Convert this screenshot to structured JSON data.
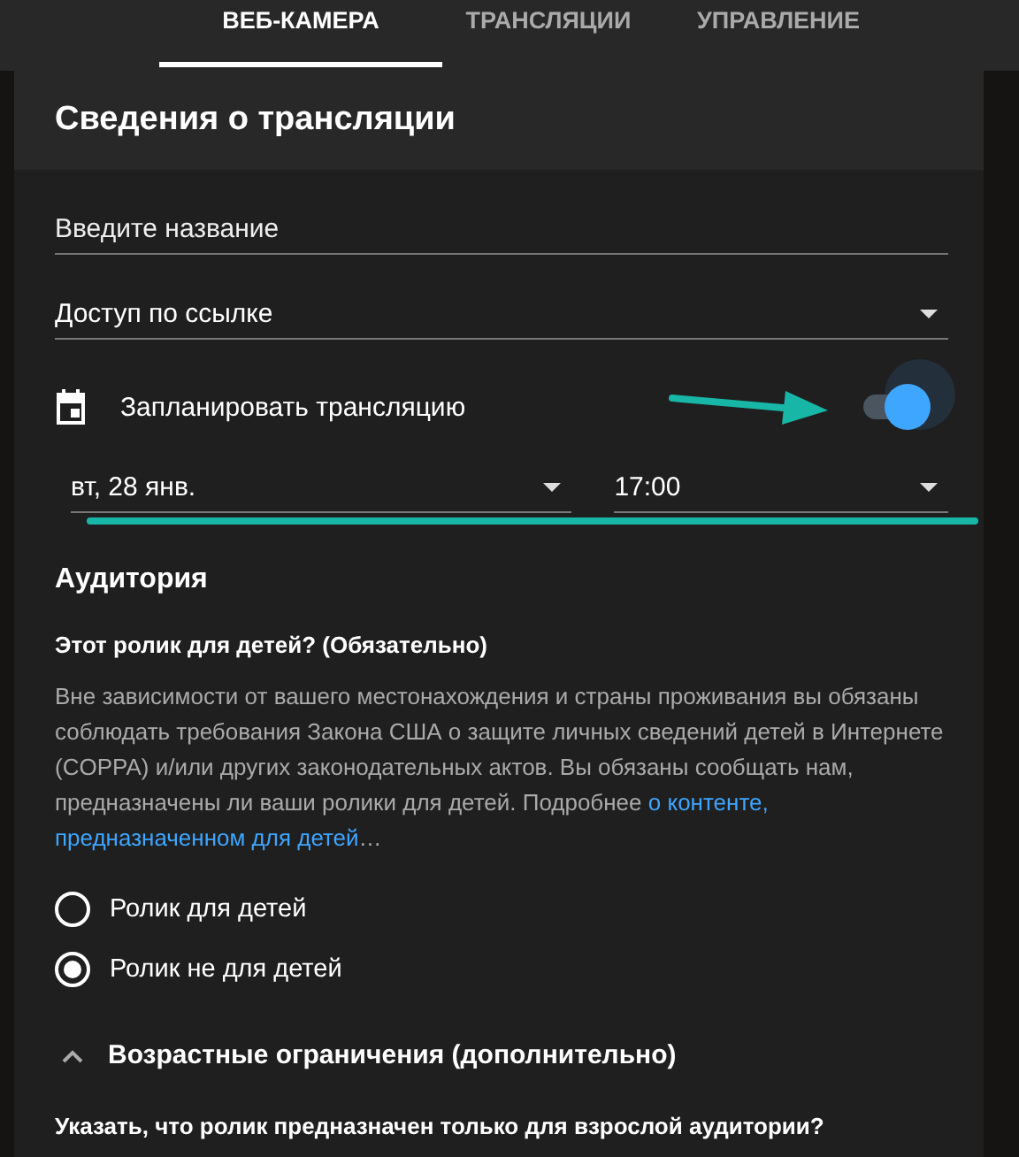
{
  "tabs": [
    {
      "label": "ВЕБ-КАМЕРА",
      "selected": true
    },
    {
      "label": "ТРАНСЛЯЦИИ",
      "selected": false
    },
    {
      "label": "УПРАВЛЕНИЕ",
      "selected": false
    }
  ],
  "panel": {
    "title": "Сведения о трансляции",
    "title_field": {
      "placeholder": "Введите название"
    },
    "visibility": {
      "value": "Доступ по ссылке"
    },
    "schedule": {
      "label": "Запланировать трансляцию",
      "on": true,
      "date": "вт, 28 янв.",
      "time": "17:00"
    },
    "audience": {
      "heading": "Аудитория",
      "question": "Этот ролик для детей? (Обязательно)",
      "text": "Вне зависимости от вашего местонахождения и страны проживания вы обязаны соблюдать требования Закона США о защите личных сведений детей в Интернете (COPPA) и/или других законодательных актов. Вы обязаны сообщать нам, предназначены ли ваши ролики для детей. Подробнее ",
      "link_lines": [
        "о контенте,",
        "предназначенном для детей"
      ],
      "after_link": "…",
      "options": [
        {
          "label": "Ролик для детей",
          "selected": false
        },
        {
          "label": "Ролик не для детей",
          "selected": true
        }
      ]
    },
    "age": {
      "label": "Возрастные ограничения (дополнительно)",
      "expanded": true,
      "question": "Указать, что ролик предназначен только для взрослой аудитории?"
    }
  }
}
